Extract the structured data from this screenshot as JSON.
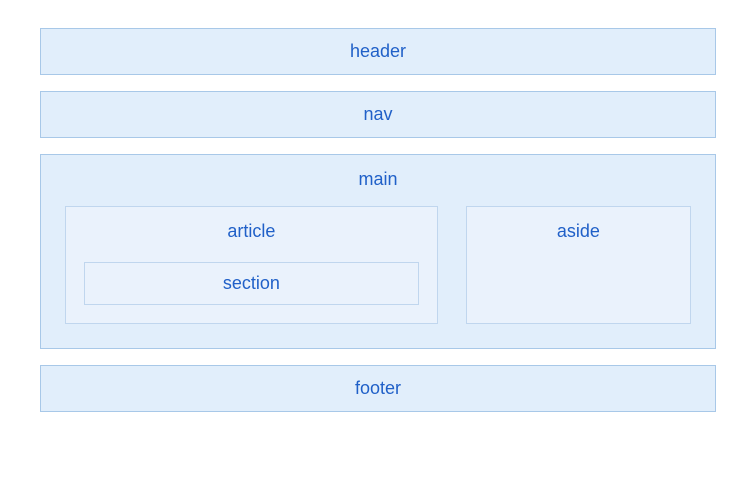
{
  "layout": {
    "header": "header",
    "nav": "nav",
    "main": "main",
    "article": "article",
    "section": "section",
    "aside": "aside",
    "footer": "footer"
  }
}
